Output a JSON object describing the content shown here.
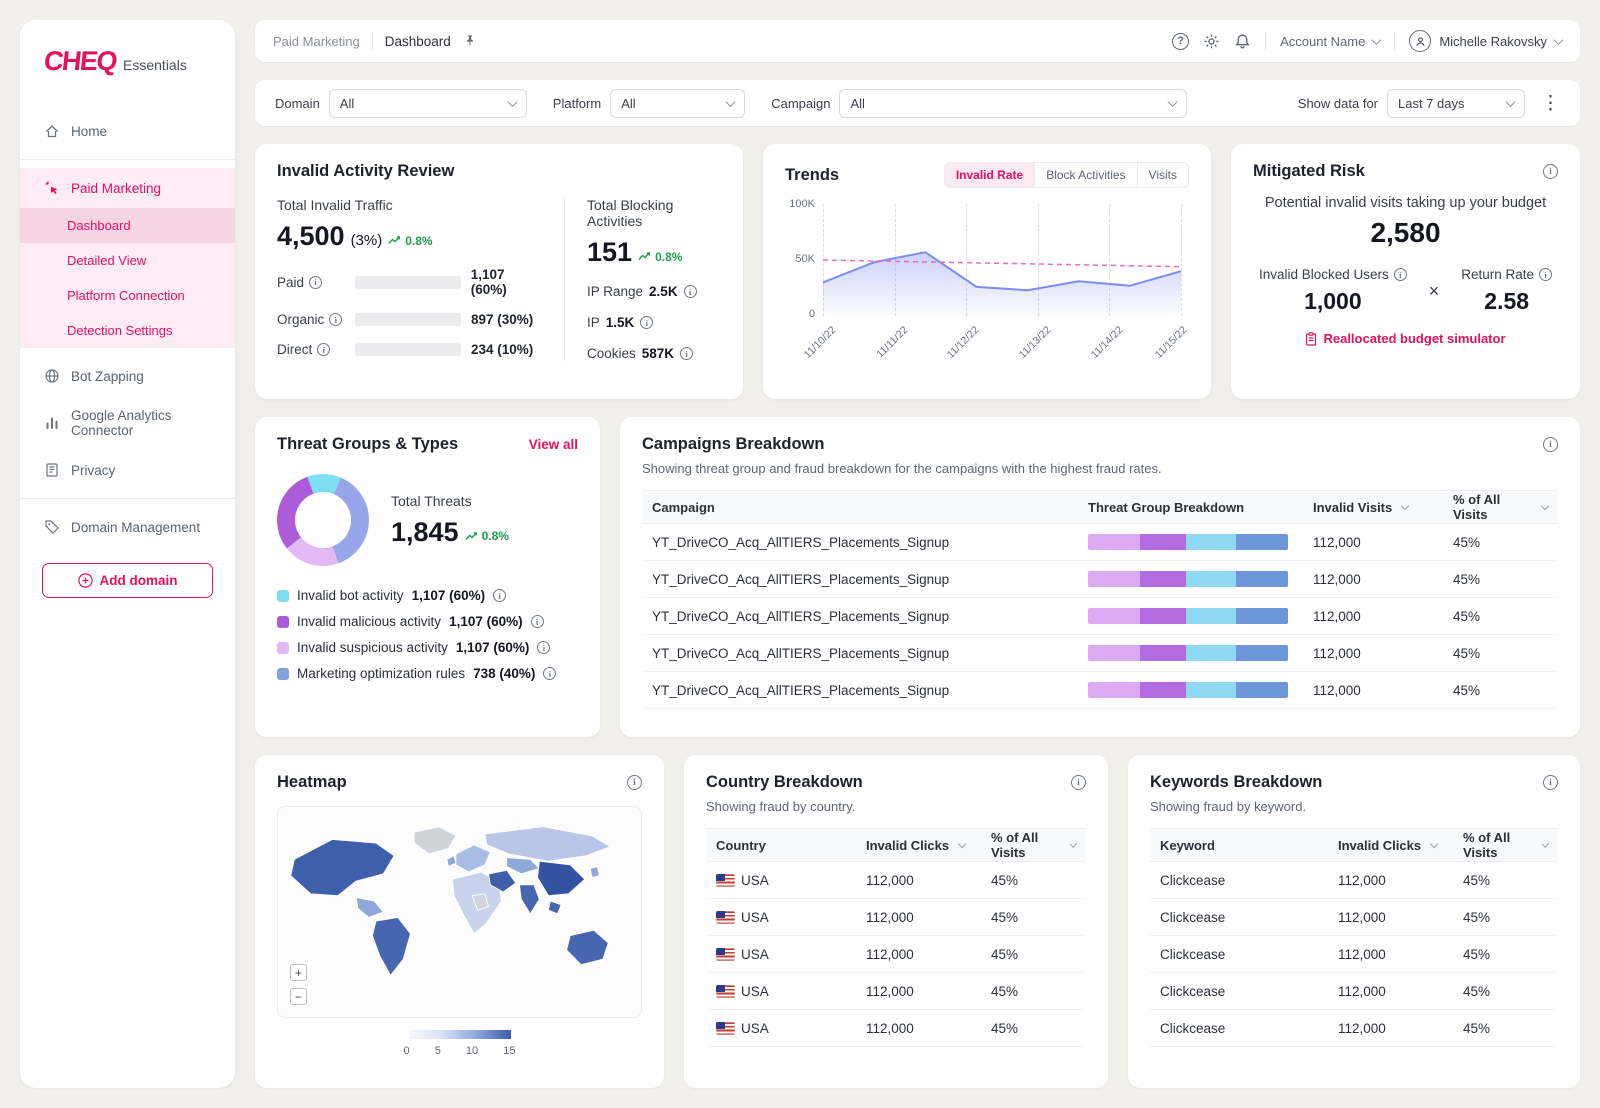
{
  "brand": {
    "logo": "CHEQ",
    "suffix": "Essentials"
  },
  "icons": {
    "kebab": "⋮",
    "zoom_in": "+",
    "zoom_out": "−"
  },
  "colors": {
    "brand": "#E6115C",
    "positive": "#1D9E4F",
    "line": "#7C8CF0",
    "trend": "#F06CB4"
  },
  "sidebar": {
    "home": "Home",
    "paid_marketing": "Paid Marketing",
    "sub": [
      "Dashboard",
      "Detailed View",
      "Platform Connection",
      "Detection Settings"
    ],
    "bot_zapping": "Bot Zapping",
    "ga_connector": "Google Analytics Connector",
    "privacy": "Privacy",
    "domain_management": "Domain Management",
    "add_domain": "Add domain"
  },
  "header": {
    "breadcrumb_section": "Paid Marketing",
    "breadcrumb_page": "Dashboard",
    "account_label": "Account Name",
    "user_name": "Michelle Rakovsky"
  },
  "filters": {
    "domain_label": "Domain",
    "domain_value": "All",
    "platform_label": "Platform",
    "platform_value": "All",
    "campaign_label": "Campaign",
    "campaign_value": "All",
    "show_label": "Show data for",
    "show_value": "Last 7 days"
  },
  "invalid_activity": {
    "title": "Invalid Activity Review",
    "traffic_label": "Total Invalid Traffic",
    "traffic_value": "4,500",
    "traffic_share": "(3%)",
    "traffic_delta": "0.8%",
    "bars": [
      {
        "label": "Paid",
        "value": "1,107 (60%)",
        "color": "#F2C556",
        "fill": 78
      },
      {
        "label": "Organic",
        "value": "897 (30%)",
        "color": "#4187C6",
        "fill": 52
      },
      {
        "label": "Direct",
        "value": "234 (10%)",
        "color": "#E8826D",
        "fill": 38
      }
    ],
    "blocking_label": "Total Blocking Activities",
    "blocking_value": "151",
    "blocking_delta": "0.8%",
    "blocking_rows": [
      {
        "label": "IP Range",
        "value": "2.5K"
      },
      {
        "label": "IP",
        "value": "1.5K"
      },
      {
        "label": "Cookies",
        "value": "587K"
      }
    ]
  },
  "trends": {
    "title": "Trends",
    "tabs": [
      "Invalid Rate",
      "Block Activities",
      "Visits"
    ]
  },
  "chart_data": [
    {
      "type": "area",
      "title": "Trends — Invalid Rate",
      "x_labels": [
        "11/10/22",
        "11/11/22",
        "11/12/22",
        "11/13/22",
        "11/14/22",
        "11/15/22"
      ],
      "values": [
        30000,
        48000,
        57000,
        26000,
        23000,
        31000,
        27000,
        40000
      ],
      "trend": [
        50000,
        44000
      ],
      "ylim": [
        0,
        100000
      ],
      "yticks": [
        "100K",
        "50K",
        "0"
      ],
      "grid": "vertical-dashed",
      "legend_position": "none"
    },
    {
      "type": "donut",
      "title": "Total Threats",
      "total": 1845,
      "segments": [
        {
          "label": "Invalid bot activity",
          "pct": 12,
          "color": "#7EDFF2"
        },
        {
          "label": "Marketing optimization rules",
          "pct": 38,
          "color": "#97A6EC"
        },
        {
          "label": "Invalid suspicious activity",
          "pct": 20,
          "color": "#E2B9F5"
        },
        {
          "label": "Invalid malicious activity",
          "pct": 30,
          "color": "#AC5BD9"
        }
      ]
    }
  ],
  "mitigated": {
    "title": "Mitigated Risk",
    "subtitle": "Potential invalid visits taking up your budget",
    "value": "2,580",
    "blocked_label": "Invalid Blocked Users",
    "blocked_value": "1,000",
    "times": "×",
    "return_label": "Return Rate",
    "return_value": "2.58",
    "link": "Reallocated budget simulator"
  },
  "threats": {
    "title": "Threat Groups & Types",
    "view_all": "View all",
    "total_label": "Total Threats",
    "total_value": "1,845",
    "delta": "0.8%",
    "legend": [
      {
        "label": "Invalid bot activity",
        "value": "1,107 (60%)",
        "color": "#7EDFF2"
      },
      {
        "label": "Invalid malicious activity",
        "value": "1,107 (60%)",
        "color": "#AC5BD9"
      },
      {
        "label": "Invalid suspicious activity",
        "value": "1,107 (60%)",
        "color": "#E2B9F5"
      },
      {
        "label": "Marketing optimization rules",
        "value": "738 (40%)",
        "color": "#7FA3DE"
      }
    ]
  },
  "campaigns": {
    "title": "Campaigns Breakdown",
    "subtitle": "Showing threat group and fraud breakdown for the campaigns with the highest fraud rates.",
    "columns": [
      "Campaign",
      "Threat Group Breakdown",
      "Invalid Visits",
      "% of All Visits"
    ],
    "segments": [
      {
        "pct": 26,
        "color": "#DCAAF2"
      },
      {
        "pct": 23,
        "color": "#B36BE0"
      },
      {
        "pct": 25,
        "color": "#8FD9F2"
      },
      {
        "pct": 26,
        "color": "#6C96D8"
      }
    ],
    "rows": [
      {
        "campaign": "YT_DriveCO_Acq_AllTIERS_Placements_Signup",
        "invalid_visits": "112,000",
        "pct": "45%"
      },
      {
        "campaign": "YT_DriveCO_Acq_AllTIERS_Placements_Signup",
        "invalid_visits": "112,000",
        "pct": "45%"
      },
      {
        "campaign": "YT_DriveCO_Acq_AllTIERS_Placements_Signup",
        "invalid_visits": "112,000",
        "pct": "45%"
      },
      {
        "campaign": "YT_DriveCO_Acq_AllTIERS_Placements_Signup",
        "invalid_visits": "112,000",
        "pct": "45%"
      },
      {
        "campaign": "YT_DriveCO_Acq_AllTIERS_Placements_Signup",
        "invalid_visits": "112,000",
        "pct": "45%"
      }
    ]
  },
  "heatmap": {
    "title": "Heatmap",
    "scale_ticks": [
      "0",
      "5",
      "10",
      "15"
    ]
  },
  "country": {
    "title": "Country Breakdown",
    "subtitle": "Showing fraud by country.",
    "columns": [
      "Country",
      "Invalid Clicks",
      "% of All Visits"
    ],
    "rows": [
      {
        "name": "USA",
        "clicks": "112,000",
        "pct": "45%"
      },
      {
        "name": "USA",
        "clicks": "112,000",
        "pct": "45%"
      },
      {
        "name": "USA",
        "clicks": "112,000",
        "pct": "45%"
      },
      {
        "name": "USA",
        "clicks": "112,000",
        "pct": "45%"
      },
      {
        "name": "USA",
        "clicks": "112,000",
        "pct": "45%"
      }
    ]
  },
  "keywords": {
    "title": "Keywords Breakdown",
    "subtitle": "Showing fraud by keyword.",
    "columns": [
      "Keyword",
      "Invalid Clicks",
      "% of All Visits"
    ],
    "rows": [
      {
        "name": "Clickcease",
        "clicks": "112,000",
        "pct": "45%"
      },
      {
        "name": "Clickcease",
        "clicks": "112,000",
        "pct": "45%"
      },
      {
        "name": "Clickcease",
        "clicks": "112,000",
        "pct": "45%"
      },
      {
        "name": "Clickcease",
        "clicks": "112,000",
        "pct": "45%"
      },
      {
        "name": "Clickcease",
        "clicks": "112,000",
        "pct": "45%"
      }
    ]
  }
}
